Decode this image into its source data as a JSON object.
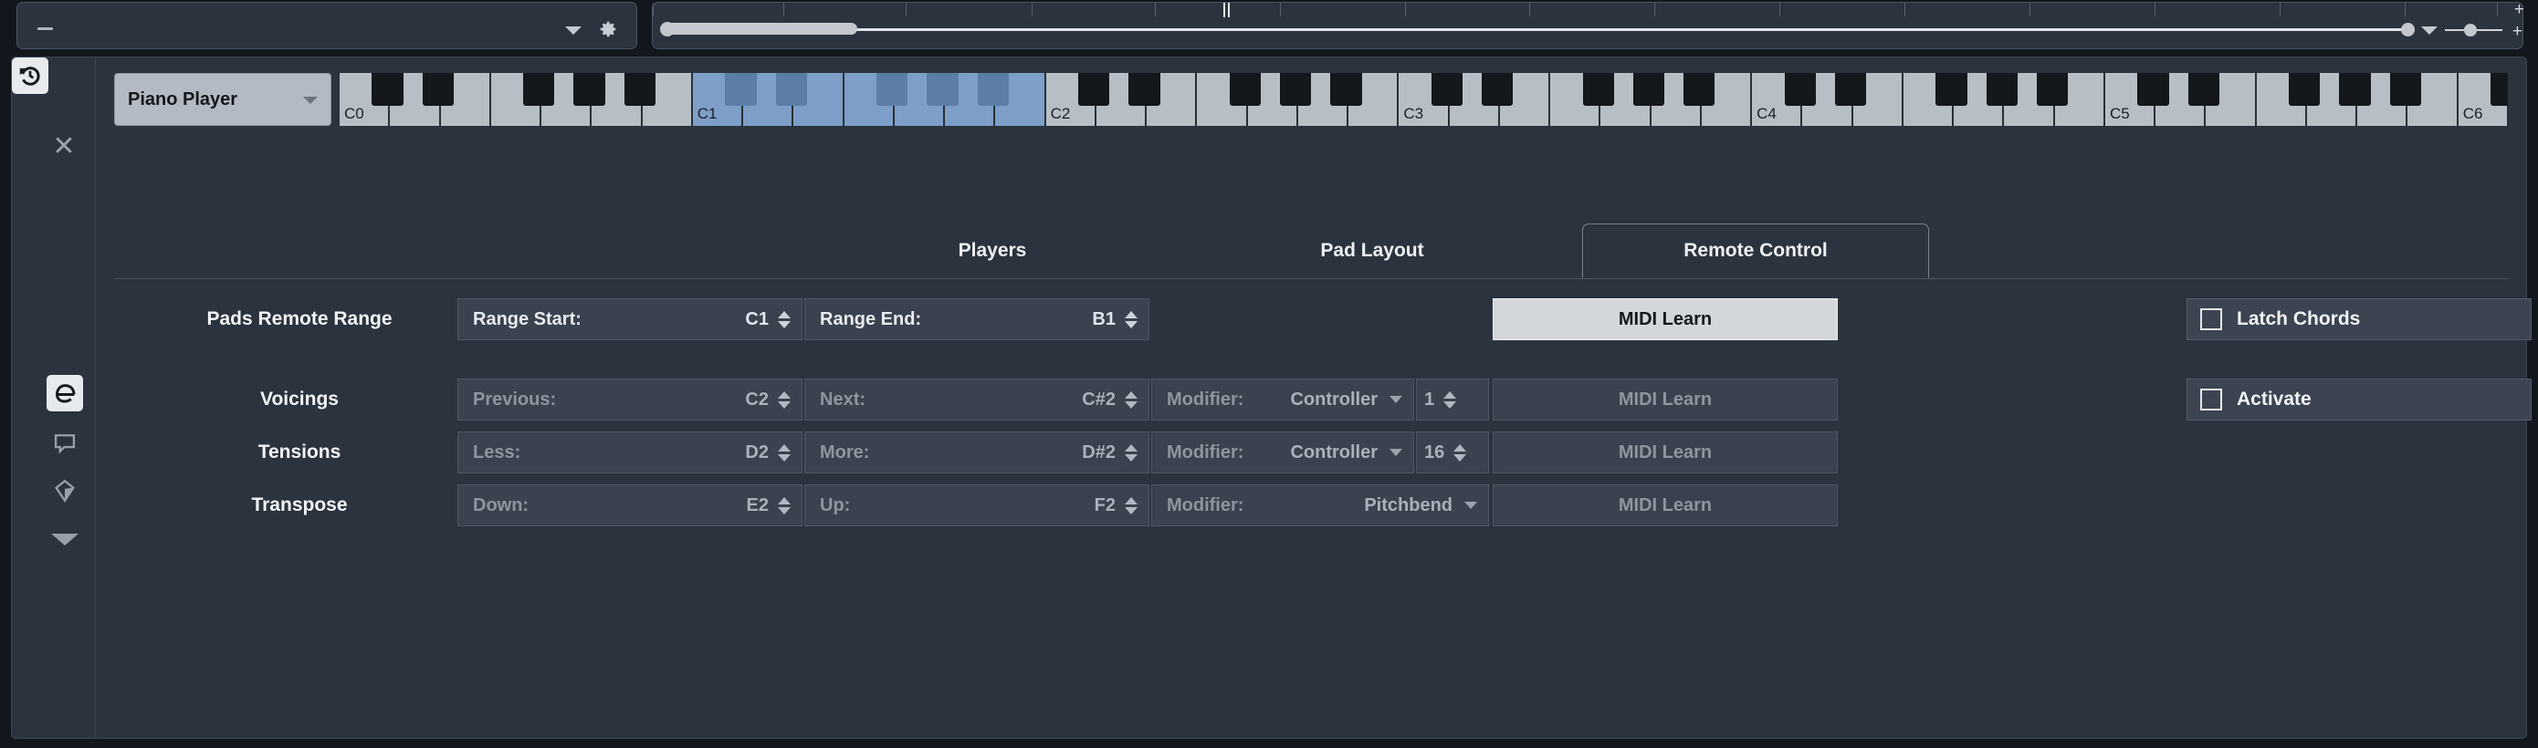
{
  "toolbar": {
    "left_value": "",
    "left_caret_icon": "chevron-down-icon",
    "gear_icon": "gear-icon",
    "plus_icon": "plus-icon"
  },
  "window": {
    "close_icon": "close-icon"
  },
  "rail": {
    "items": [
      {
        "name": "editor",
        "icon": "edit-e-icon",
        "active": true
      },
      {
        "name": "comment",
        "icon": "speech-bubble-icon",
        "active": false
      },
      {
        "name": "layers",
        "icon": "cube-icon",
        "active": false
      },
      {
        "name": "more",
        "icon": "chevron-down-icon",
        "active": false
      }
    ],
    "reset": {
      "name": "reset",
      "icon": "reset-clock-icon"
    }
  },
  "header": {
    "player_select": {
      "value": "Piano Player",
      "caret_icon": "chevron-down-icon"
    },
    "keyboard": {
      "octave_labels": [
        "C0",
        "C1",
        "C2",
        "C3",
        "C4",
        "C5",
        "C6"
      ],
      "selected_range_start": "C1",
      "selected_range_end": "B1"
    }
  },
  "tabs": [
    {
      "label": "Players",
      "active": false
    },
    {
      "label": "Pad Layout",
      "active": false
    },
    {
      "label": "Remote Control",
      "active": true
    }
  ],
  "rows": {
    "pads": {
      "label": "Pads Remote Range",
      "start": {
        "name": "Range Start:",
        "value": "C1"
      },
      "end": {
        "name": "Range End:",
        "value": "B1"
      },
      "learn": "MIDI Learn",
      "checkbox": {
        "label": "Latch Chords",
        "checked": false
      }
    },
    "voicings": {
      "label": "Voicings",
      "prev": {
        "name": "Previous:",
        "value": "C2"
      },
      "next": {
        "name": "Next:",
        "value": "C#2"
      },
      "modifier": {
        "name": "Modifier:",
        "value": "Controller"
      },
      "cc": "1",
      "learn": "MIDI Learn",
      "checkbox": {
        "label": "Activate",
        "checked": false
      }
    },
    "tensions": {
      "label": "Tensions",
      "prev": {
        "name": "Less:",
        "value": "D2"
      },
      "next": {
        "name": "More:",
        "value": "D#2"
      },
      "modifier": {
        "name": "Modifier:",
        "value": "Controller"
      },
      "cc": "16",
      "learn": "MIDI Learn"
    },
    "transpose": {
      "label": "Transpose",
      "prev": {
        "name": "Down:",
        "value": "E2"
      },
      "next": {
        "name": "Up:",
        "value": "F2"
      },
      "modifier": {
        "name": "Modifier:",
        "value": "Pitchbend"
      },
      "learn": "MIDI Learn"
    }
  },
  "colors": {
    "panel_bg": "#2b333e",
    "field_bg": "#39424e",
    "key_selected": "#7c9ec7",
    "button_enabled": "#d3d7dc"
  }
}
